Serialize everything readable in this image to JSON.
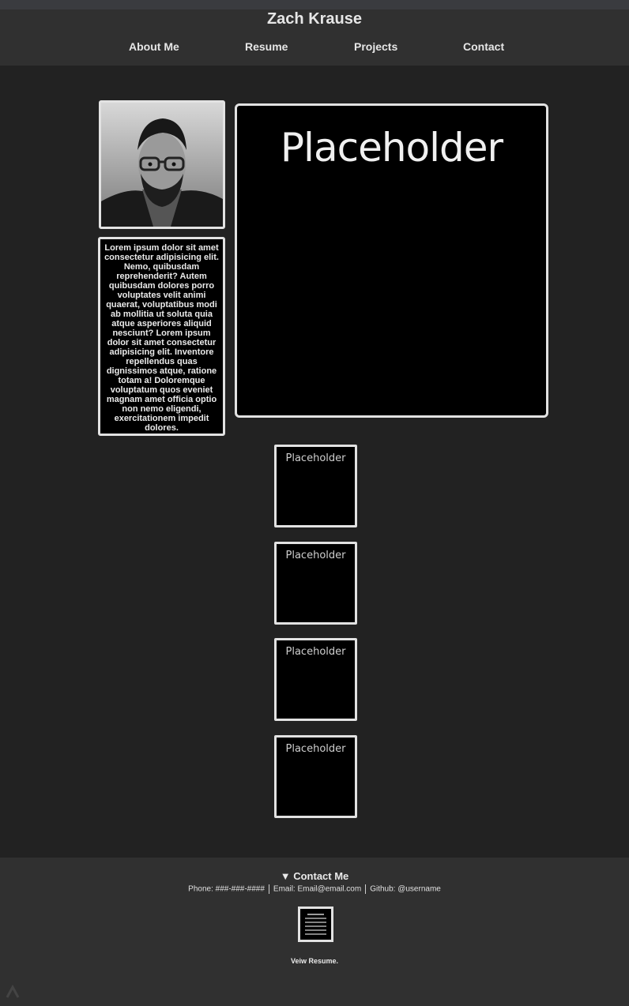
{
  "header": {
    "title": "Zach Krause",
    "nav": [
      "About Me",
      "Resume",
      "Projects",
      "Contact"
    ]
  },
  "profile": {
    "bio": "Lorem ipsum dolor sit amet consectetur adipisicing elit. Nemo, quibusdam reprehenderit? Autem quibusdam dolores porro voluptates velit animi quaerat, voluptatibus modi ab mollitia ut soluta quia atque asperiores aliquid nesciunt? Lorem ipsum dolor sit amet consectetur adipisicing elit. Inventore repellendus quas dignissimos atque, ratione totam a! Doloremque voluptatum quos eveniet magnam amet officia optio non nemo eligendi, exercitationem impedit dolores."
  },
  "feature": {
    "title": "Placeholder"
  },
  "thumbnails": [
    {
      "title": "Placeholder"
    },
    {
      "title": "Placeholder"
    },
    {
      "title": "Placeholder"
    },
    {
      "title": "Placeholder"
    }
  ],
  "footer": {
    "heading": "Contact Me",
    "phone": "Phone: ###-###-####",
    "email": "Email: Email@email.com",
    "github": "Github: @username",
    "resume_label": "Veiw Resume.",
    "resume_icon": "document-icon"
  },
  "colors": {
    "background": "#222222",
    "header": "#303030",
    "card_border": "#e2e2e2"
  }
}
